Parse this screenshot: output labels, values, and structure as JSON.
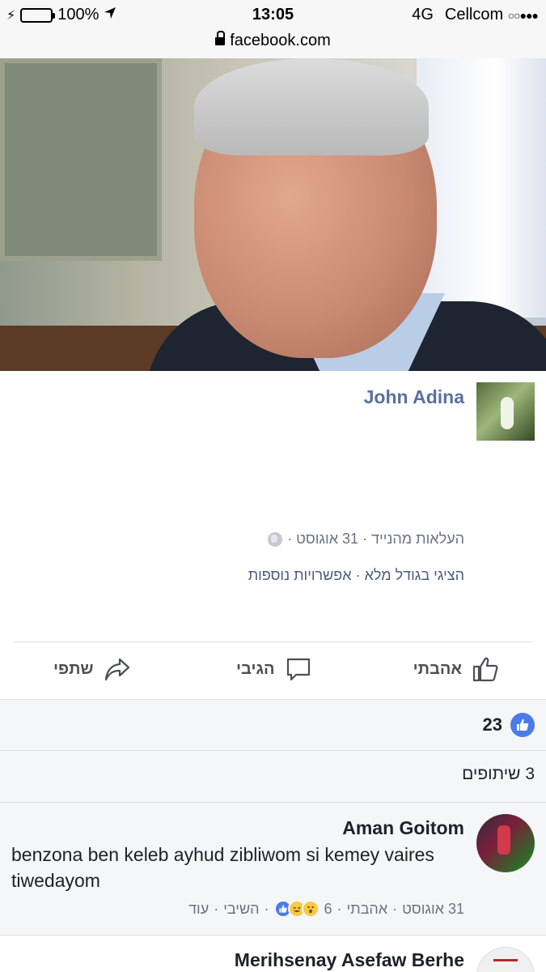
{
  "status_bar": {
    "battery_text": "100%",
    "time": "13:05",
    "network": "4G",
    "carrier": "Cellcom",
    "signal": "○○●●●"
  },
  "url_bar": {
    "domain": "facebook.com"
  },
  "post": {
    "author": "John Adina",
    "meta": "העלאות מהנייד · 31 אוגוסט ·",
    "links": "הציגי בגודל מלא · אפשרויות נוספות",
    "actions": {
      "like": "אהבתי",
      "comment": "הגיבי",
      "share": "שתפי"
    },
    "reactions_count": "23",
    "shares": "3 שיתופים"
  },
  "comments": [
    {
      "author": "Aman Goitom",
      "text": "benzona ben keleb ayhud zibliwom si kemey vaires tiwedayom",
      "date": "31 אוגוסט",
      "like": "אהבתי",
      "reaction_count": "6",
      "reply": "השיבי",
      "more": "עוד"
    },
    {
      "author": "Merihsenay Asefaw Berhe"
    }
  ],
  "colors": {
    "name_link": "#5b6fa0",
    "like_blue": "#4a7bea",
    "panel_gray": "#f5f6f7"
  }
}
